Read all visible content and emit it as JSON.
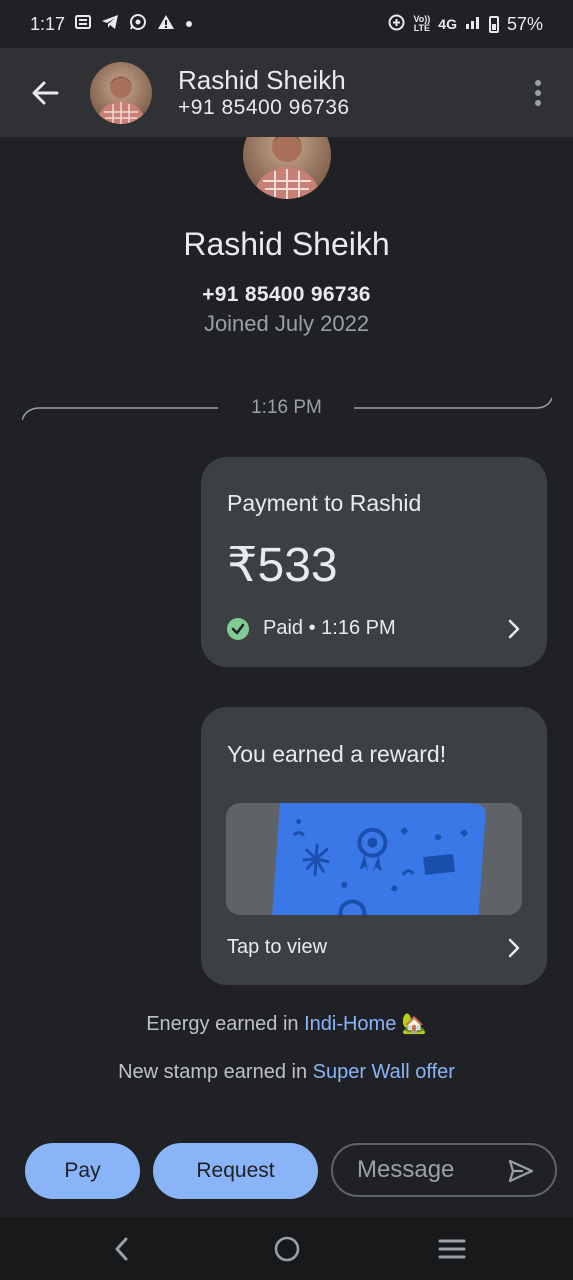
{
  "status_bar": {
    "time": "1:17",
    "network": "4G",
    "volte_top": "Vo))",
    "volte_bottom": "LTE",
    "battery": "57%"
  },
  "header": {
    "name": "Rashid Sheikh",
    "phone": "+91 85400 96736"
  },
  "profile": {
    "name": "Rashid Sheikh",
    "phone": "+91 85400 96736",
    "joined": "Joined July 2022"
  },
  "timeline": {
    "time": "1:16 PM"
  },
  "payment": {
    "title": "Payment to Rashid",
    "amount": "₹533",
    "status": "Paid • 1:16 PM"
  },
  "reward": {
    "title": "You earned a reward!",
    "action": "Tap to view"
  },
  "notes": {
    "energy_prefix": "Energy earned in ",
    "energy_link": "Indi-Home",
    "energy_emoji": "🏡",
    "stamp_prefix": "New stamp earned in ",
    "stamp_link": "Super Wall offer"
  },
  "actions": {
    "pay": "Pay",
    "request": "Request",
    "message_placeholder": "Message"
  },
  "icons": {
    "back": "arrow-left-icon",
    "more": "more-vert-icon",
    "check": "check-circle-icon",
    "chevron": "chevron-right-icon",
    "send": "send-icon",
    "nav_back": "nav-back-icon",
    "nav_home": "nav-home-icon",
    "nav_menu": "nav-menu-icon"
  },
  "colors": {
    "background": "#202124",
    "header": "#303134",
    "card": "#3c4043",
    "accent": "#8ab4f8",
    "success": "#81c995",
    "reward_card": "#3b78e7"
  }
}
